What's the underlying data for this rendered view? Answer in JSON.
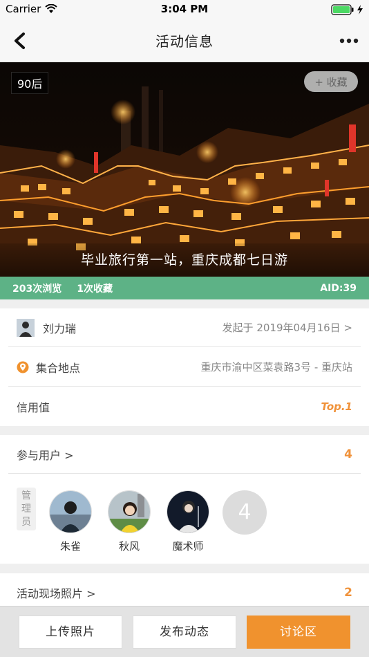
{
  "status_bar": {
    "carrier": "Carrier",
    "time": "3:04 PM"
  },
  "nav": {
    "title": "活动信息",
    "back_icon": "chevron-left-icon",
    "more_icon": "ellipsis-icon"
  },
  "hero": {
    "tag": "90后",
    "favorite_label": "+ 收藏",
    "caption": "毕业旅行第一站，重庆成都七日游"
  },
  "stats": {
    "views": "203次浏览",
    "favorites": "1次收藏",
    "aid": "AID:39"
  },
  "info": {
    "organizer": "刘力瑞",
    "initiated": "发起于 2019年04月16日 >",
    "meeting_label": "集合地点",
    "meeting_address": "重庆市渝中区菜袁路3号 - 重庆站",
    "credit_label": "信用值",
    "credit_value": "Top.1"
  },
  "participants": {
    "header": "参与用户 >",
    "count": "4",
    "admin_tag": "管\n理\n员",
    "members": [
      {
        "name": "朱雀"
      },
      {
        "name": "秋风"
      },
      {
        "name": "魔术师"
      }
    ],
    "more": "4"
  },
  "photos": {
    "header": "活动现场照片 >",
    "count": "2"
  },
  "toolbar": {
    "upload": "上传照片",
    "post": "发布动态",
    "discussion": "讨论区"
  },
  "colors": {
    "accent_orange": "#f0922e",
    "stats_green": "#5db286"
  }
}
